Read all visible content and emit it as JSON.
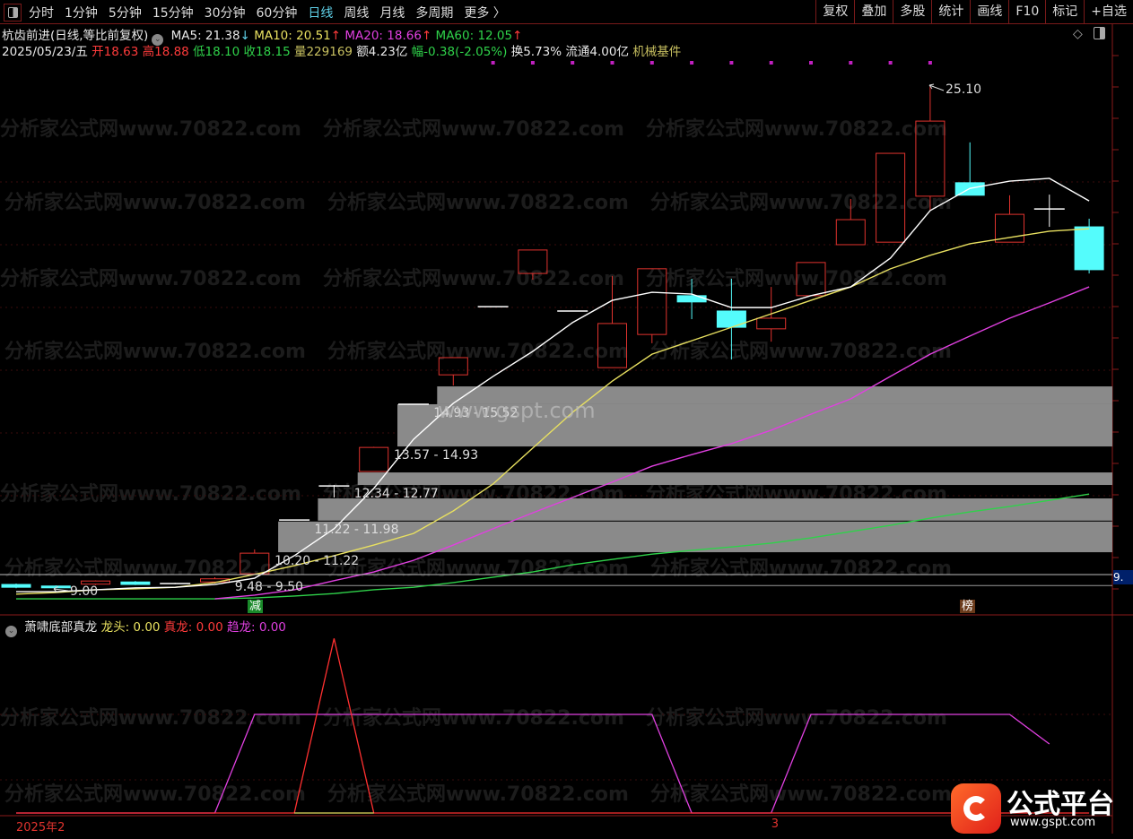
{
  "toolbar": {
    "periods": [
      "分时",
      "1分钟",
      "5分钟",
      "15分钟",
      "30分钟",
      "60分钟",
      "日线",
      "周线",
      "月线",
      "多周期",
      "更多 〉"
    ],
    "active_period": "日线",
    "actions": [
      "复权",
      "叠加",
      "多股",
      "统计",
      "画线",
      "F10",
      "标记",
      "+自选"
    ]
  },
  "stock": {
    "title": "杭齿前进(日线,等比前复权)",
    "ma5": "MA5: 21.38",
    "ma5_dir": "↓",
    "ma10": "MA10: 20.51",
    "ma10_dir": "↑",
    "ma20": "MA20: 18.66",
    "ma20_dir": "↑",
    "ma60": "MA60: 12.05",
    "ma60_dir": "↑",
    "date": "2025/05/23/五",
    "open": "开18.63",
    "high": "高18.88",
    "low": "低18.10",
    "close": "收18.15",
    "volume": "量229169",
    "amount": "额4.23亿",
    "change": "幅-0.38(-2.05%)",
    "turnover": "换5.73%",
    "float": "流通4.00亿",
    "sector": "机械基件"
  },
  "annotations": {
    "high_label": "25.10",
    "low_label": "9.00",
    "price_tag": "9.",
    "badge_jian": "减",
    "badge_bang": "榜",
    "corner_diamond": "◇"
  },
  "colors": {
    "up": "#e0332e",
    "down": "#54fcfc",
    "ma5": "#ffffff",
    "ma10": "#e8e060",
    "ma20": "#e040e0",
    "ma60": "#2fd24a",
    "zone": "#8a8a8a"
  },
  "chart_data": {
    "type": "candlestick",
    "candles_ohlc": [
      [
        9.17,
        9.2,
        9.05,
        9.08
      ],
      [
        9.12,
        9.14,
        9.08,
        9.1
      ],
      [
        9.18,
        9.3,
        9.15,
        9.28
      ],
      [
        9.25,
        9.28,
        9.15,
        9.17
      ],
      [
        9.2,
        9.22,
        9.18,
        9.2
      ],
      [
        9.25,
        9.4,
        9.2,
        9.35
      ],
      [
        9.51,
        10.29,
        9.48,
        10.17
      ],
      [
        11.23,
        11.23,
        11.23,
        11.23
      ],
      [
        12.32,
        12.35,
        11.95,
        12.32
      ],
      [
        12.78,
        13.57,
        12.77,
        13.55
      ],
      [
        14.93,
        14.93,
        14.93,
        14.93
      ],
      [
        15.87,
        16.43,
        15.53,
        16.42
      ],
      [
        18.05,
        18.05,
        18.05,
        18.05
      ],
      [
        19.11,
        19.86,
        18.91,
        19.86
      ],
      [
        17.91,
        17.91,
        17.91,
        17.91
      ],
      [
        16.1,
        19.03,
        16.1,
        17.51
      ],
      [
        17.16,
        19.26,
        16.88,
        19.26
      ],
      [
        18.4,
        18.94,
        17.65,
        18.2
      ],
      [
        17.91,
        18.94,
        16.36,
        17.39
      ],
      [
        17.34,
        18.68,
        16.93,
        17.68
      ],
      [
        18.4,
        19.46,
        18.4,
        19.46
      ],
      [
        20.03,
        21.49,
        20.03,
        20.83
      ],
      [
        20.11,
        22.95,
        20.11,
        22.95
      ],
      [
        21.58,
        25.1,
        21.12,
        23.98
      ],
      [
        22.01,
        23.3,
        21.61,
        21.61
      ],
      [
        20.11,
        21.61,
        20.11,
        21.0
      ],
      [
        21.17,
        21.63,
        20.6,
        21.17
      ],
      [
        20.6,
        20.86,
        19.11,
        19.23
      ]
    ],
    "ma5": [
      8.94,
      8.94,
      9.0,
      9.06,
      9.08,
      9.17,
      9.37,
      10.09,
      10.95,
      12.24,
      13.81,
      14.96,
      15.82,
      16.62,
      17.54,
      18.25,
      18.51,
      18.45,
      18.02,
      18.02,
      18.4,
      18.68,
      19.6,
      21.12,
      21.83,
      22.06,
      22.15,
      21.43
    ],
    "ma10": [
      8.86,
      8.91,
      9.0,
      9.03,
      9.08,
      9.23,
      9.49,
      9.77,
      10.09,
      10.43,
      10.8,
      11.52,
      12.38,
      13.53,
      14.67,
      15.67,
      16.53,
      16.96,
      17.39,
      17.82,
      18.25,
      18.68,
      19.26,
      19.69,
      20.06,
      20.26,
      20.46,
      20.54
    ],
    "ma20": [
      null,
      null,
      null,
      null,
      null,
      8.71,
      8.83,
      9.0,
      9.29,
      9.57,
      9.94,
      10.43,
      10.95,
      11.46,
      11.95,
      12.44,
      12.95,
      13.32,
      13.67,
      14.1,
      14.61,
      15.1,
      15.82,
      16.53,
      17.11,
      17.68,
      18.17,
      18.68
    ],
    "ma60": [
      8.71,
      8.71,
      8.71,
      8.71,
      8.71,
      8.71,
      8.74,
      8.8,
      8.88,
      9.0,
      9.08,
      9.23,
      9.4,
      9.57,
      9.8,
      9.97,
      10.14,
      10.26,
      10.37,
      10.49,
      10.66,
      10.86,
      11.06,
      11.29,
      11.49,
      11.66,
      11.86,
      12.06
    ],
    "zones": [
      {
        "start": 11,
        "low": 14.93,
        "high": 15.5,
        "label": "14.93 - 15.52"
      },
      {
        "start": 10,
        "low": 13.58,
        "high": 14.93,
        "label": "13.57 - 14.93"
      },
      {
        "start": 9,
        "low": 12.35,
        "high": 12.75,
        "label": "12.34 - 12.77"
      },
      {
        "start": 8,
        "low": 11.21,
        "high": 11.92,
        "label": "11.22 - 11.98"
      },
      {
        "start": 7,
        "low": 10.2,
        "high": 11.18,
        "label": "10.20 - 11.22"
      },
      {
        "start": 6,
        "low": 9.48,
        "high": 9.5,
        "label": "9.48 - 9.50"
      }
    ],
    "signal_dots_from_index": 12,
    "x_labels": [
      {
        "index": 0,
        "label": "2025年2"
      },
      {
        "index": 19,
        "label": "3"
      }
    ]
  },
  "indicator": {
    "name": "萧啸底部真龙",
    "longtou": "龙头: 0.00",
    "zhenlong": "真龙: 0.00",
    "qulong": "趋龙: 0.00",
    "qulong_series": [
      0,
      0,
      0,
      0,
      0,
      0,
      1,
      1,
      1,
      1,
      1,
      1,
      1,
      1,
      1,
      1,
      1,
      0,
      0,
      0,
      1,
      1,
      1,
      1,
      1,
      1,
      0.7,
      null
    ],
    "zhenlong_series": [
      0,
      0,
      0,
      0,
      0,
      0,
      0,
      0,
      1.77,
      0,
      0,
      0,
      0,
      0,
      0,
      0,
      0,
      0,
      0,
      0,
      0,
      0,
      0,
      0,
      0,
      0,
      0,
      0
    ],
    "longtou_series": [
      null,
      null,
      null,
      null,
      null,
      null,
      null,
      0,
      0,
      0,
      null,
      null,
      null,
      null,
      null,
      null,
      null,
      null,
      null,
      null,
      null,
      null,
      null,
      null,
      null,
      null,
      null,
      null
    ]
  },
  "watermark": {
    "text": "分析家公式网www.70822.com",
    "site": "www.gspt.com"
  },
  "logo": {
    "name": "公式平台",
    "url": "www.gspt.com"
  }
}
